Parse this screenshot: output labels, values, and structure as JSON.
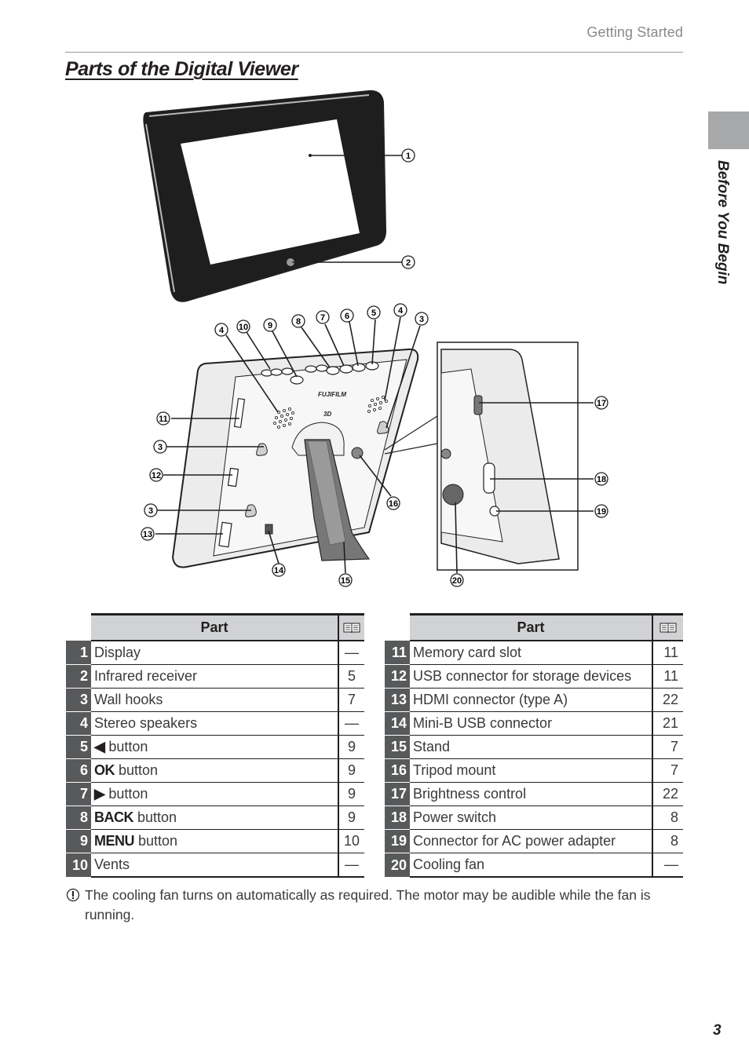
{
  "header": {
    "section_label": "Getting Started",
    "title": "Parts of the Digital Viewer"
  },
  "side_tab": {
    "label": "Before You Begin",
    "tab_color": "#a7a8aa"
  },
  "figure": {
    "brand_text": "FUJIFILM",
    "model_text": "3D",
    "callouts_front": [
      "1",
      "2"
    ],
    "callouts_back_top": [
      "4",
      "10",
      "9",
      "8",
      "7",
      "6",
      "5",
      "4",
      "3"
    ],
    "callouts_back_left": [
      "11",
      "3",
      "12",
      "3",
      "13"
    ],
    "callouts_back_bottom": [
      "14",
      "15",
      "16"
    ],
    "callouts_side": [
      "17",
      "18",
      "19",
      "20"
    ]
  },
  "tables": {
    "header_part": "Part",
    "header_page_icon": "book-icon",
    "left_rows": [
      {
        "num": "1",
        "prefix": "",
        "part": "Display",
        "page": "—"
      },
      {
        "num": "2",
        "prefix": "",
        "part": "Infrared receiver",
        "page": "5"
      },
      {
        "num": "3",
        "prefix": "",
        "part": "Wall hooks",
        "page": "7"
      },
      {
        "num": "4",
        "prefix": "",
        "part": "Stereo speakers",
        "page": "—"
      },
      {
        "num": "5",
        "prefix": "◀",
        "part": " button",
        "page": "9"
      },
      {
        "num": "6",
        "prefix": "OK",
        "part": " button",
        "page": "9"
      },
      {
        "num": "7",
        "prefix": "▶",
        "part": " button",
        "page": "9"
      },
      {
        "num": "8",
        "prefix": "BACK",
        "part": " button",
        "page": "9"
      },
      {
        "num": "9",
        "prefix": "MENU",
        "part": " button",
        "page": "10"
      },
      {
        "num": "10",
        "prefix": "",
        "part": "Vents",
        "page": "—"
      }
    ],
    "right_rows": [
      {
        "num": "11",
        "part": "Memory card slot",
        "page": "11"
      },
      {
        "num": "12",
        "part": "USB connector for storage devices",
        "page": "11"
      },
      {
        "num": "13",
        "part": "HDMI connector (type A)",
        "page": "22"
      },
      {
        "num": "14",
        "part": "Mini-B USB connector",
        "page": "21"
      },
      {
        "num": "15",
        "part": "Stand",
        "page": "7"
      },
      {
        "num": "16",
        "part": "Tripod mount",
        "page": "7"
      },
      {
        "num": "17",
        "part": "Brightness control",
        "page": "22"
      },
      {
        "num": "18",
        "part": "Power switch",
        "page": "8"
      },
      {
        "num": "19",
        "part": "Connector for AC power adapter",
        "page": "8"
      },
      {
        "num": "20",
        "part": "Cooling fan",
        "page": "—"
      }
    ]
  },
  "note": {
    "icon": "caution-icon",
    "text": "The cooling fan turns on automatically as required. The motor may be audible while the fan is running."
  },
  "page_number": "3"
}
